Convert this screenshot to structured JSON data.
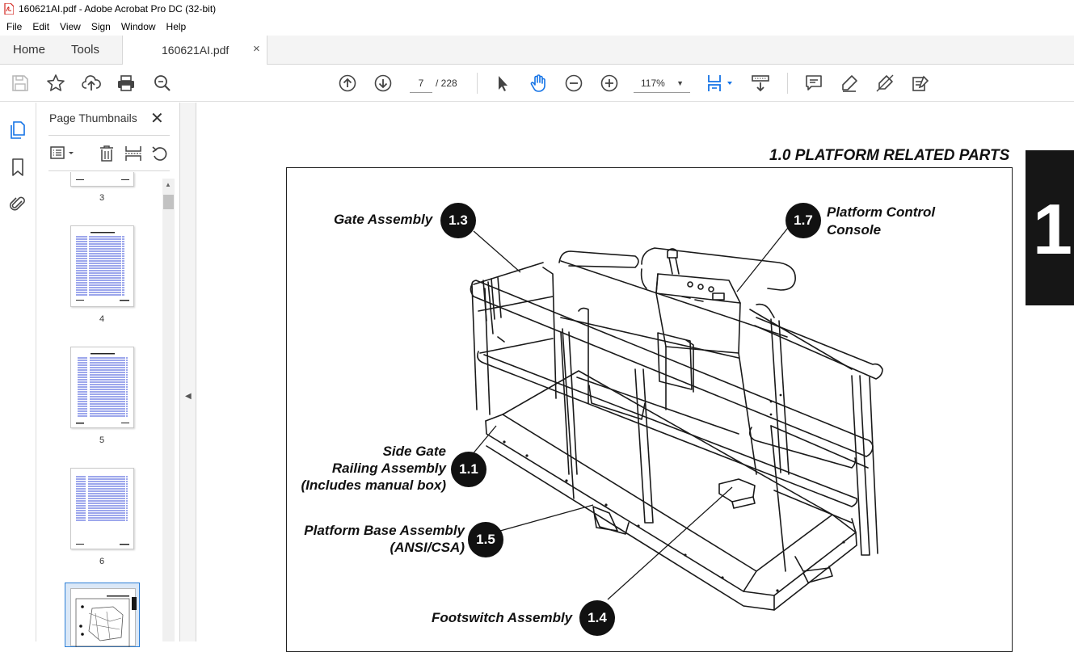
{
  "window": {
    "title": "160621AI.pdf - Adobe Acrobat Pro DC (32-bit)"
  },
  "menu": [
    "File",
    "Edit",
    "View",
    "Sign",
    "Window",
    "Help"
  ],
  "tabs": {
    "home": "Home",
    "tools": "Tools",
    "document": "160621AI.pdf",
    "close": "×"
  },
  "toolbar": {
    "current_page": "7",
    "page_total": "/ 228",
    "zoom": "117%",
    "icons": [
      "save-icon",
      "star-icon",
      "upload-icon",
      "print-icon",
      "search-icon",
      "page-up-icon",
      "page-down-icon",
      "select-arrow-icon",
      "hand-icon",
      "zoom-out-icon",
      "zoom-in-icon",
      "fit-page-icon",
      "scroll-mode-icon",
      "comment-icon",
      "highlight-icon",
      "sign-icon",
      "fill-sign-icon"
    ]
  },
  "panel": {
    "title": "Page Thumbnails",
    "close": "✕",
    "thumbnails": [
      {
        "label": "3"
      },
      {
        "label": "4"
      },
      {
        "label": "5"
      },
      {
        "label": "6"
      },
      {
        "label": "7",
        "selected": true
      }
    ]
  },
  "document": {
    "section_title": "1.0  PLATFORM RELATED PARTS",
    "tab_number": "1",
    "callouts": [
      {
        "text": "Gate Assembly",
        "badge": "1.3"
      },
      {
        "text_line1": "Platform Control",
        "text_line2": "Console",
        "badge": "1.7"
      },
      {
        "text_line1": "Side Gate",
        "text_line2": "Railing Assembly",
        "text_line3": "(Includes manual box)",
        "badge": "1.1"
      },
      {
        "text_line1": "Platform Base Assembly",
        "text_line2": "(ANSI/CSA)",
        "badge": "1.5"
      },
      {
        "text": "Footswitch Assembly",
        "badge": "1.4"
      }
    ]
  },
  "colors": {
    "accent_link": "#3b4fd9",
    "tab_block": "#161616",
    "selected_thumb_border": "#2c7fd6"
  }
}
